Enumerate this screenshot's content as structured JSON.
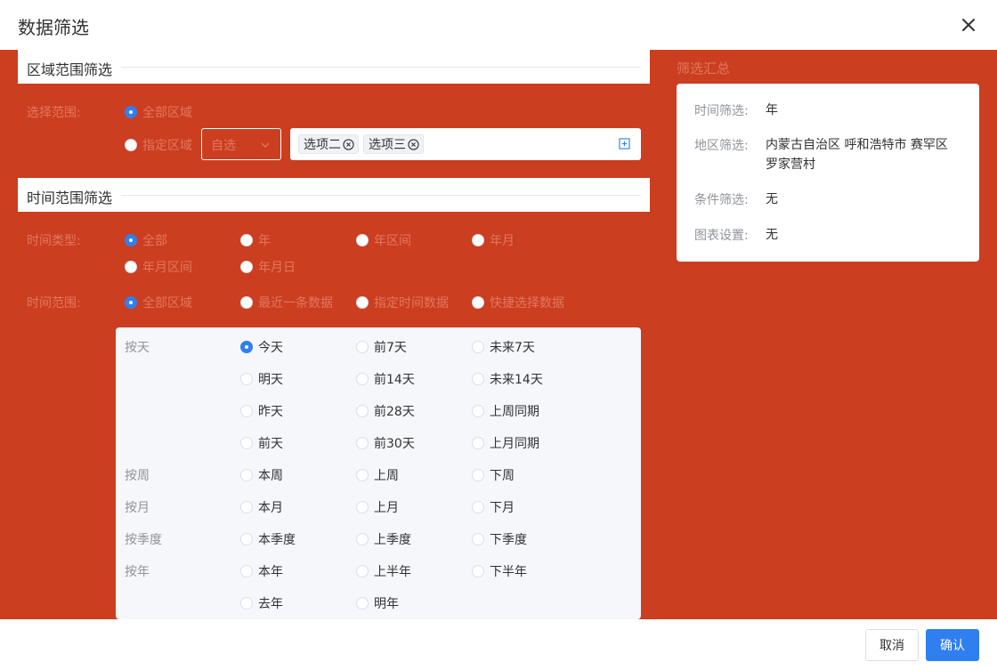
{
  "dialog": {
    "title": "数据筛选"
  },
  "region": {
    "section_title": "区域范围筛选",
    "scope_label": "选择范围:",
    "options": [
      {
        "label": "全部区域",
        "checked": true
      },
      {
        "label": "指定区域",
        "checked": false
      }
    ],
    "select_value": "自选",
    "tags": [
      "选项二",
      "选项三"
    ]
  },
  "time": {
    "section_title": "时间范围筛选",
    "type_label": "时间类型:",
    "types": [
      {
        "label": "全部",
        "checked": true
      },
      {
        "label": "年",
        "checked": false
      },
      {
        "label": "年区间",
        "checked": false
      },
      {
        "label": "年月",
        "checked": false
      },
      {
        "label": "年月区间",
        "checked": false
      },
      {
        "label": "年月日",
        "checked": false
      }
    ],
    "range_label": "时间范围:",
    "ranges": [
      {
        "label": "全部区域",
        "checked": true
      },
      {
        "label": "最近一条数据",
        "checked": false
      },
      {
        "label": "指定时间数据",
        "checked": false
      },
      {
        "label": "快捷选择数据",
        "checked": false
      }
    ]
  },
  "quick": {
    "groups": [
      {
        "label": "按天",
        "options": [
          "今天",
          "前7天",
          "未来7天",
          "明天",
          "前14天",
          "未来14天",
          "昨天",
          "前28天",
          "上周同期",
          "前天",
          "前30天",
          "上月同期"
        ]
      },
      {
        "label": "按周",
        "options": [
          "本周",
          "上周",
          "下周"
        ]
      },
      {
        "label": "按月",
        "options": [
          "本月",
          "上月",
          "下月"
        ]
      },
      {
        "label": "按季度",
        "options": [
          "本季度",
          "上季度",
          "下季度"
        ]
      },
      {
        "label": "按年",
        "options": [
          "本年",
          "上半年",
          "下半年",
          "去年",
          "明年"
        ]
      }
    ],
    "selected": "今天"
  },
  "summary": {
    "title": "筛选汇总",
    "rows": [
      {
        "label": "时间筛选:",
        "value": "年"
      },
      {
        "label": "地区筛选:",
        "value": "内蒙古自治区 呼和浩特市 赛罕区 罗家营村"
      },
      {
        "label": "条件筛选:",
        "value": "无"
      },
      {
        "label": "图表设置:",
        "value": "无"
      }
    ]
  },
  "footer": {
    "cancel_label": "取消",
    "ok_label": "确认"
  },
  "colors": {
    "panel_bg": "#cc3e20",
    "accent": "#2f7ff0",
    "muted_text_on_red": "#e0785f"
  },
  "icons": {
    "close": "close-icon",
    "chevron": "chevron-down-icon",
    "tag_remove": "close-circle-icon",
    "add": "plus-square-icon"
  }
}
